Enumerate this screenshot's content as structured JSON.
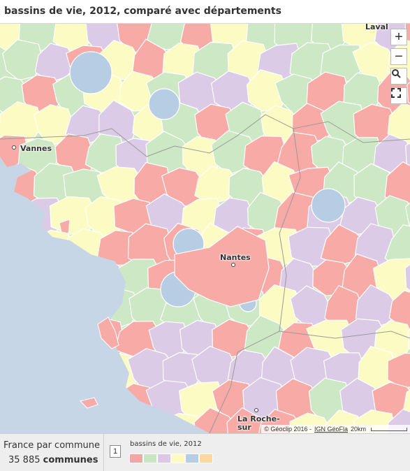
{
  "header": {
    "title": "bassins de vie, 2012, comparé avec départements"
  },
  "map": {
    "cities": [
      {
        "name": "Laval"
      },
      {
        "name": "Vannes"
      },
      {
        "name": "Nantes"
      },
      {
        "name": "La Roche-\nsur"
      }
    ],
    "controls": [
      {
        "name": "zoom-in",
        "glyph": "+"
      },
      {
        "name": "zoom-out",
        "glyph": "−"
      },
      {
        "name": "search",
        "glyph": "🔍"
      },
      {
        "name": "fullscreen",
        "glyph": "⛶"
      }
    ],
    "attribution": {
      "text": "© Géoclip 2016 -",
      "link": "IGN GéoFla",
      "scale": "20km"
    }
  },
  "footer": {
    "line1": "France par commune",
    "count": "35 885",
    "unit": "communes",
    "page": "1",
    "legend_title": "bassins de vie, 2012"
  },
  "legend": {
    "colors": [
      "#f4a6a6",
      "#c8e6c0",
      "#dcc8e6",
      "#fffbc0",
      "#b5cce2",
      "#fcd8a0"
    ]
  },
  "palette": {
    "pink": "#f7aaa6",
    "green": "#cde8c4",
    "purple": "#dccbe6",
    "yellow": "#fdfbc4",
    "blue": "#b6cde3",
    "sea": "#c6d6e6",
    "border": "#ffffff"
  }
}
